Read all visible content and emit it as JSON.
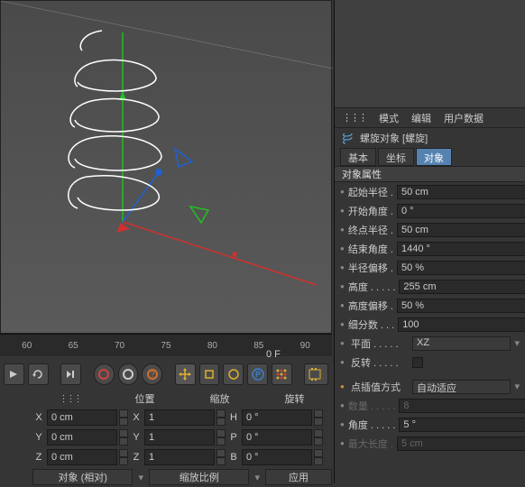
{
  "timeline": {
    "ticks": [
      "60",
      "65",
      "70",
      "75",
      "80",
      "85",
      "90"
    ],
    "frame": "0 F"
  },
  "coord": {
    "headers": {
      "pos": "位置",
      "scale": "缩放",
      "rotate": "旋转"
    },
    "rows": [
      {
        "axis": "X",
        "pos": "0 cm",
        "sclaxis": "X",
        "scl": "1",
        "rotaxis": "H",
        "rot": "0 °"
      },
      {
        "axis": "Y",
        "pos": "0 cm",
        "sclaxis": "Y",
        "scl": "1",
        "rotaxis": "P",
        "rot": "0 °"
      },
      {
        "axis": "Z",
        "pos": "0 cm",
        "sclaxis": "Z",
        "scl": "1",
        "rotaxis": "B",
        "rot": "0 °"
      }
    ],
    "posmode": "对象 (相对)",
    "sclmode": "缩放比例",
    "apply": "应用"
  },
  "menu": {
    "mode": "模式",
    "edit": "编辑",
    "userdata": "用户数据"
  },
  "obj": {
    "title": "螺旋对象 [螺旋]"
  },
  "tabs": {
    "basic": "基本",
    "coord": "坐标",
    "object": "对象"
  },
  "section": "对象属性",
  "props": {
    "startRadius": {
      "label": "起始半径 .",
      "value": "50 cm"
    },
    "startAngle": {
      "label": "开始角度 .",
      "value": "0 °"
    },
    "endRadius": {
      "label": "终点半径 .",
      "value": "50 cm"
    },
    "endAngle": {
      "label": "结束角度 .",
      "value": "1440 °"
    },
    "radiusBias": {
      "label": "半径偏移 .",
      "value": "50 %"
    },
    "height": {
      "label": "高度 . . . . .",
      "value": "255 cm"
    },
    "heightBias": {
      "label": "高度偏移 .",
      "value": "50 %"
    },
    "subdiv": {
      "label": "细分数 . . .",
      "value": "100"
    },
    "plane": {
      "label": "平面 . . . . .",
      "value": "XZ"
    },
    "reverse": {
      "label": "反转 . . . . ."
    },
    "interp": {
      "label": "点插值方式",
      "value": "自动适应"
    },
    "count": {
      "label": "数量 . . . . .",
      "value": "8"
    },
    "angle": {
      "label": "角度 . . . . .",
      "value": "5 °"
    },
    "maxlen": {
      "label": "最大长度 .",
      "value": "5 cm"
    }
  }
}
